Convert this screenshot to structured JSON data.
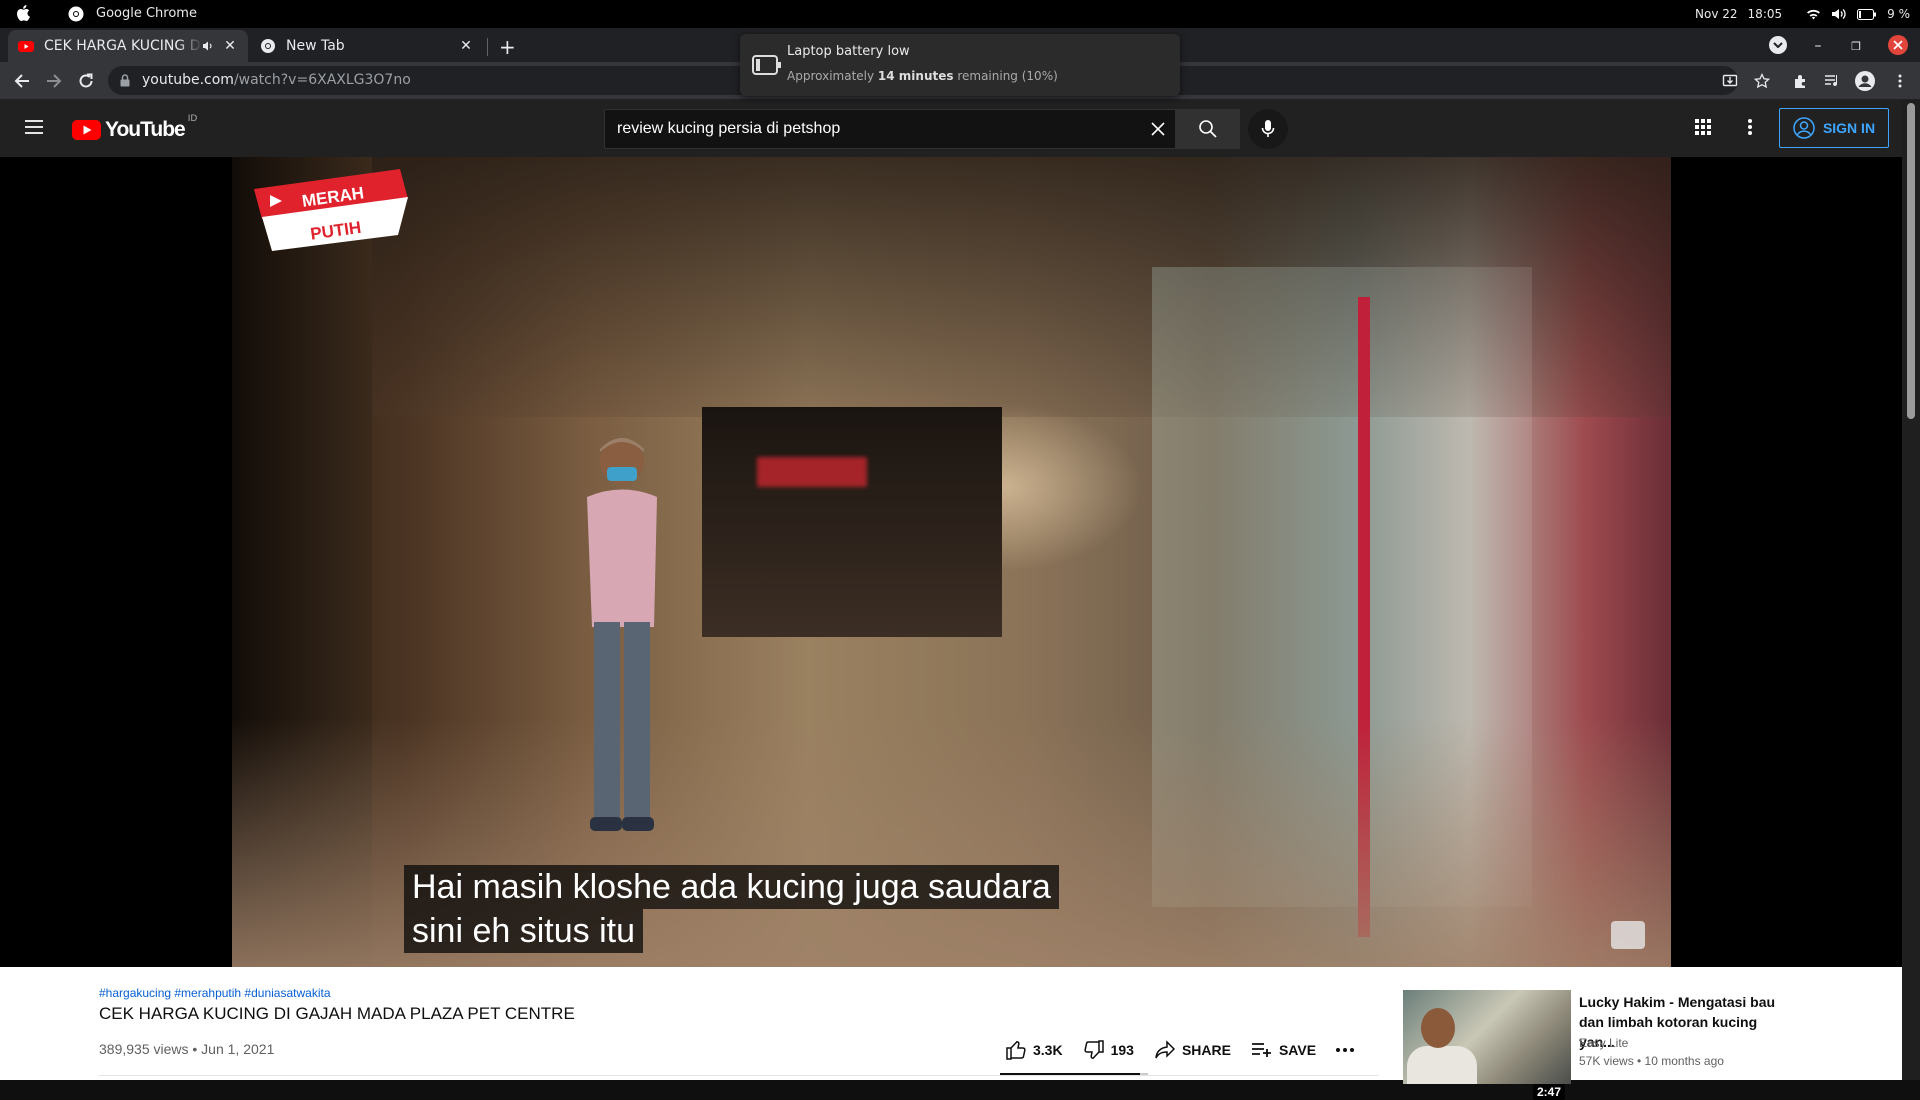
{
  "os": {
    "app_name": "Google Chrome",
    "date": "Nov 22",
    "time": "18:05",
    "battery_percent": "9 %"
  },
  "browser": {
    "tabs": [
      {
        "title": "CEK HARGA KUCING DI GAJAH MADA PLAZA PET CENTRE - YouTube",
        "active": true
      },
      {
        "title": "New Tab",
        "active": false
      }
    ],
    "url_host": "youtube.com",
    "url_path": "/watch?v=6XAXLG3O7no"
  },
  "notification": {
    "title": "Laptop battery low",
    "prefix": "Approximately ",
    "bold": "14 minutes",
    "suffix": " remaining (10%)"
  },
  "youtube": {
    "logo_text": "YouTube",
    "country": "ID",
    "search_value": "review kucing persia di petshop",
    "sign_in_label": "SIGN IN",
    "brand_color": "#ff0000"
  },
  "video": {
    "watermark_line1": "MERAH",
    "watermark_line2": "PUTIH",
    "caption_line1": "Hai masih kloshe ada kucing juga saudara",
    "caption_line2": "sini eh situs itu",
    "tags": "#hargakucing #merahputih #duniasatwakita",
    "title": "CEK HARGA KUCING DI GAJAH MADA PLAZA PET CENTRE",
    "views_date": "389,935 views • Jun 1, 2021",
    "likes": "3.3K",
    "dislikes": "193",
    "share_label": "SHARE",
    "save_label": "SAVE",
    "like_ratio": 0.945
  },
  "recommendation": {
    "title": "Lucky Hakim - Mengatasi bau dan limbah kotoran kucing yan...",
    "channel": "Easy Lite",
    "meta": "57K views • 10 months ago",
    "duration": "2:47"
  }
}
